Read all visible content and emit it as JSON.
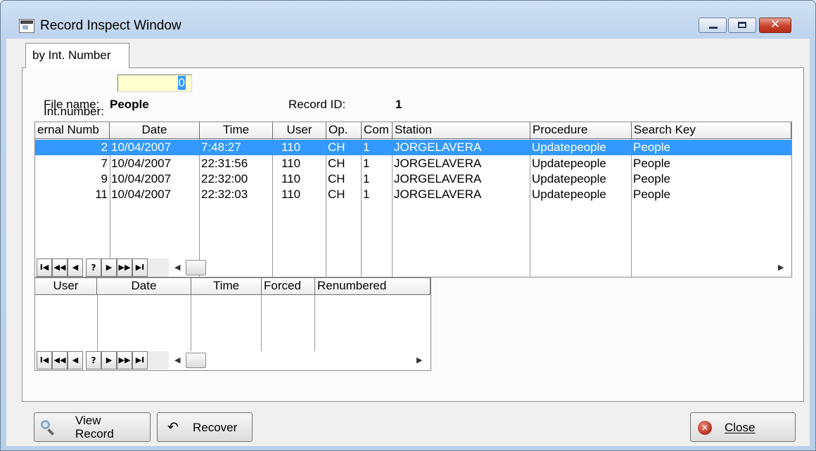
{
  "window": {
    "title": "Record Inspect Window",
    "controls": {
      "minimize": "minimize",
      "maximize": "maximize",
      "close": "✕"
    }
  },
  "tabs": [
    {
      "label": "by Int. Number",
      "active": true
    }
  ],
  "form": {
    "int_number_label": "Int.number:",
    "int_number_value": "0",
    "file_name_label": "File name:",
    "file_name_value": "People",
    "record_id_label": "Record ID:",
    "record_id_value": "1"
  },
  "history_table": {
    "columns": [
      "ernal Numb",
      "Date",
      "Time",
      "User",
      "Op.",
      "Com",
      "Station",
      "Procedure",
      "Search Key"
    ],
    "rows": [
      {
        "number": "2",
        "date": "10/04/2007",
        "time": "7:48:27",
        "user": "110",
        "op": "CH",
        "com": "1",
        "station": "JORGELAVERA",
        "procedure": "Updatepeople",
        "search_key": "People",
        "selected": true
      },
      {
        "number": "7",
        "date": "10/04/2007",
        "time": "22:31:56",
        "user": "110",
        "op": "CH",
        "com": "1",
        "station": "JORGELAVERA",
        "procedure": "Updatepeople",
        "search_key": "People",
        "selected": false
      },
      {
        "number": "9",
        "date": "10/04/2007",
        "time": "22:32:00",
        "user": "110",
        "op": "CH",
        "com": "1",
        "station": "JORGELAVERA",
        "procedure": "Updatepeople",
        "search_key": "People",
        "selected": false
      },
      {
        "number": "11",
        "date": "10/04/2007",
        "time": "22:32:03",
        "user": "110",
        "op": "CH",
        "com": "1",
        "station": "JORGELAVERA",
        "procedure": "Updatepeople",
        "search_key": "People",
        "selected": false
      }
    ]
  },
  "recovery_table": {
    "columns": [
      "User",
      "Date",
      "Time",
      "Forced",
      "Renumbered"
    ],
    "rows": []
  },
  "navigator": {
    "first": "I◀",
    "prev_page": "◀◀",
    "prev": "◀",
    "search": "?",
    "next": "▶",
    "next_page": "▶▶",
    "last": "▶I",
    "scroll_left": "◀",
    "scroll_right": "▶"
  },
  "buttons": {
    "view_record": "View\nRecord",
    "view_record_line1": "View",
    "view_record_line2": "Record",
    "recover": "Recover",
    "close": "Close",
    "undo_icon": "↶",
    "close_icon": "✕"
  },
  "colors": {
    "selection": "#3399ff",
    "input_background": "#ffffd0",
    "close_button": "#c8412b"
  }
}
